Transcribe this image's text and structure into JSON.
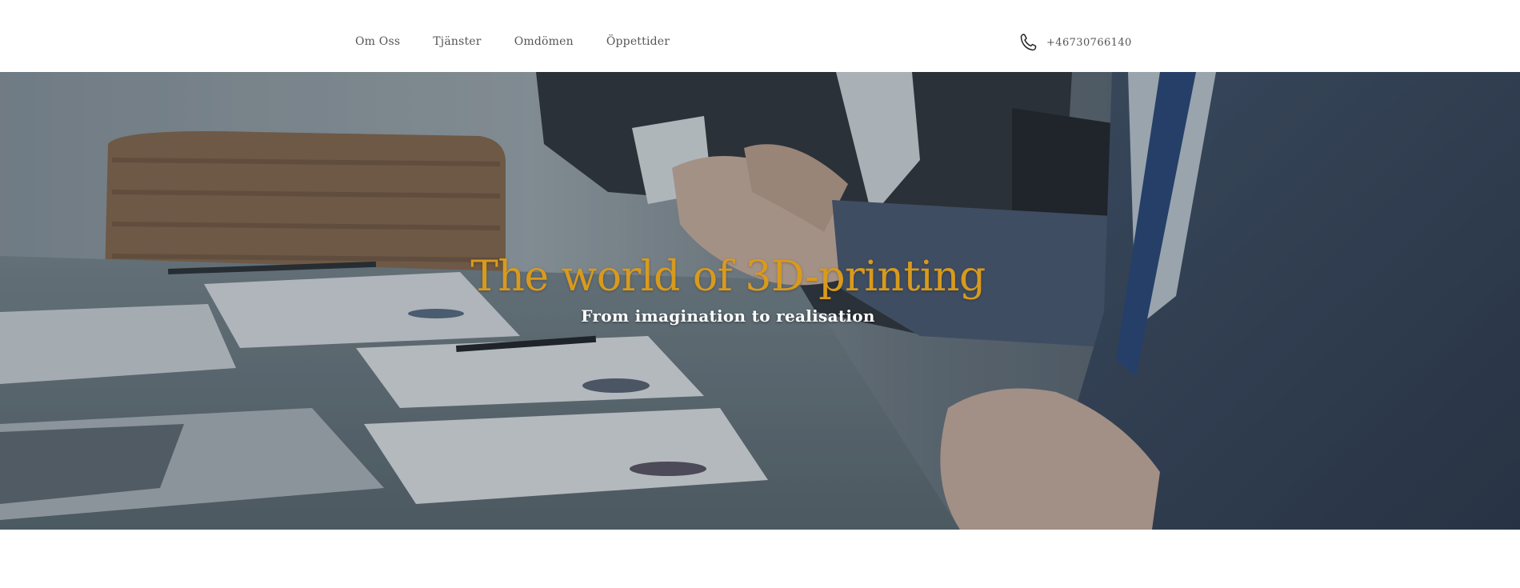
{
  "nav": {
    "items": [
      {
        "label": "Om Oss"
      },
      {
        "label": "Tjänster"
      },
      {
        "label": "Omdömen"
      },
      {
        "label": "Öppettider"
      }
    ]
  },
  "contact": {
    "phone": "+46730766140",
    "icon": "phone-icon"
  },
  "hero": {
    "title": "The world of 3D-printing",
    "subtitle": "From imagination to realisation",
    "image": "business-handshake-photo"
  },
  "colors": {
    "accent": "#d99a1c",
    "nav_text": "#555555",
    "header_bg": "#ffffff",
    "subtitle": "#ffffff"
  }
}
